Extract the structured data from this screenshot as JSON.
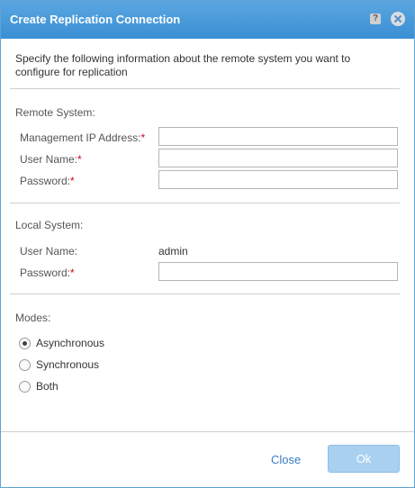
{
  "dialog": {
    "title": "Create Replication Connection",
    "help_label": "?",
    "intro": "Specify the following information about the remote system you want to configure for replication"
  },
  "remote": {
    "section_title": "Remote System:",
    "mgmt_ip_label": "Management IP Address:",
    "username_label": "User Name:",
    "password_label": "Password:",
    "mgmt_ip_value": "",
    "username_value": "",
    "password_value": ""
  },
  "local": {
    "section_title": "Local System:",
    "username_label": "User Name:",
    "username_value": "admin",
    "password_label": "Password:",
    "password_value": ""
  },
  "modes": {
    "section_title": "Modes:",
    "options": [
      {
        "label": "Asynchronous",
        "checked": true
      },
      {
        "label": "Synchronous",
        "checked": false
      },
      {
        "label": "Both",
        "checked": false
      }
    ]
  },
  "footer": {
    "close_label": "Close",
    "ok_label": "Ok"
  },
  "required_marker": "*",
  "colors": {
    "titlebar": "#3a8fd4",
    "required": "#d0021b",
    "ok_button": "#a9d0ef",
    "link": "#3a7fc4"
  }
}
